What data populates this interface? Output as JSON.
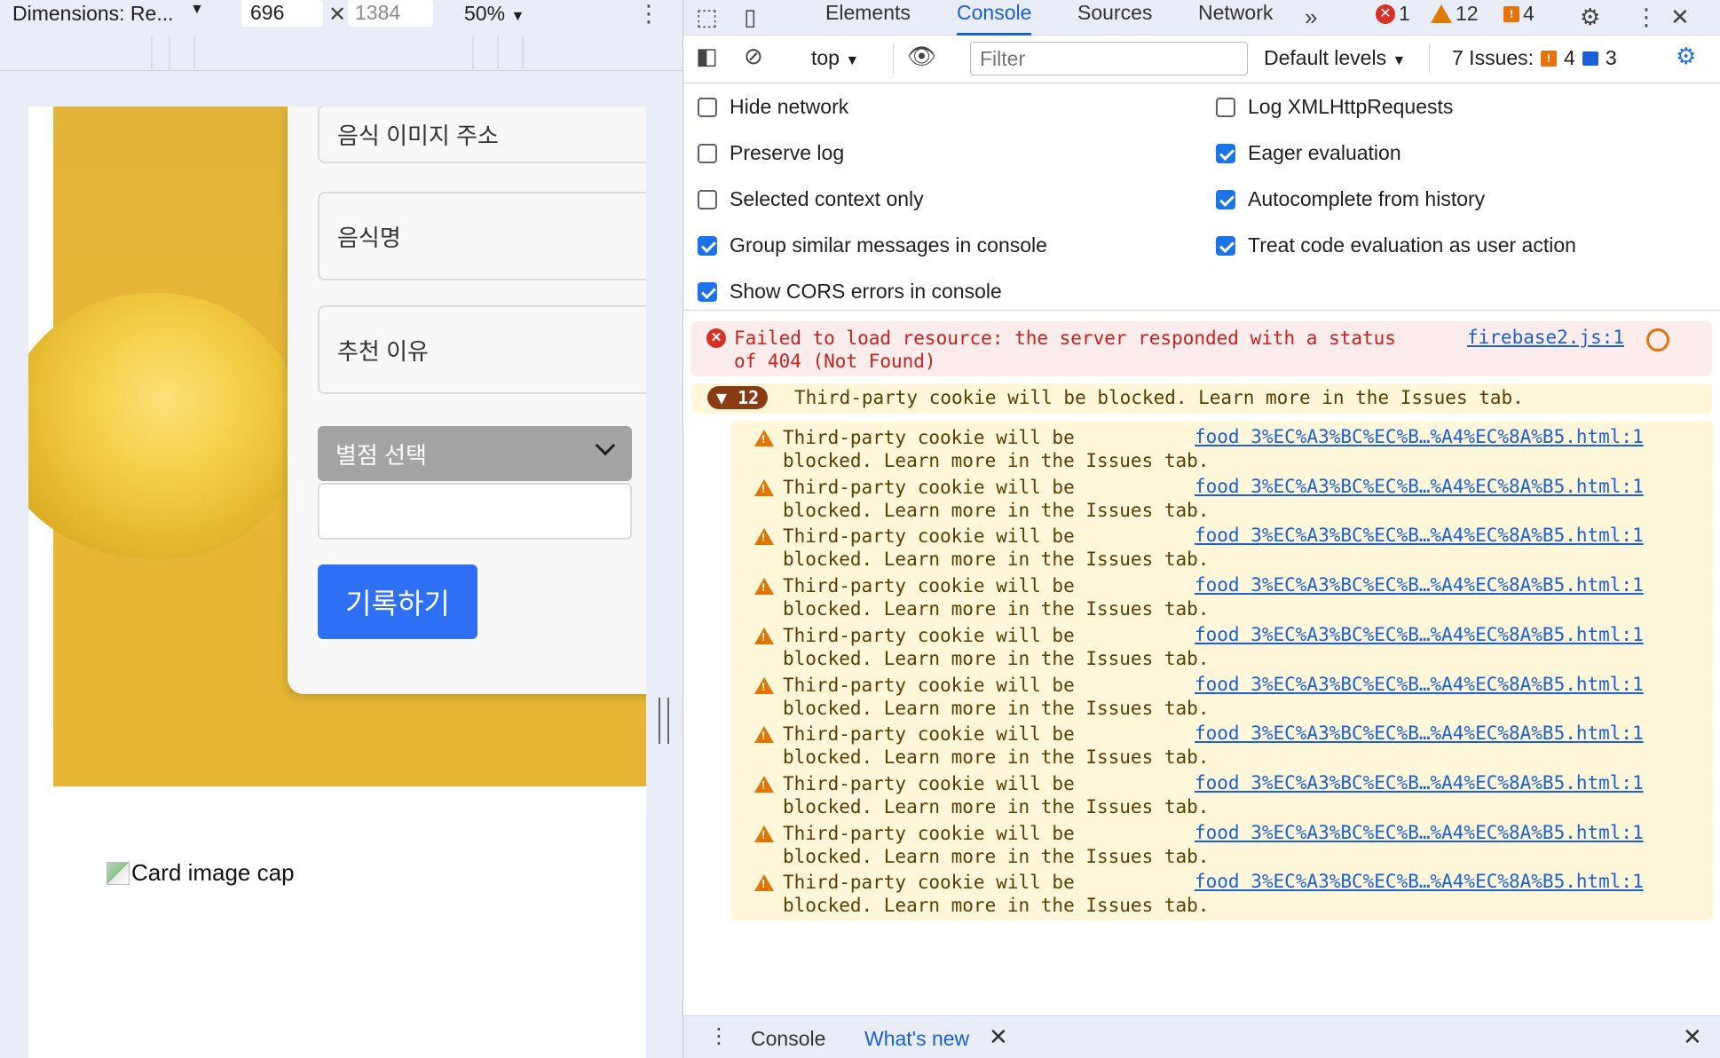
{
  "device_toolbar": {
    "dimensions_label": "Dimensions: Re...",
    "width_value": "696",
    "height_value": "1384",
    "zoom_label": "50%"
  },
  "page": {
    "fields": [
      "음식 이미지 주소",
      "음식명",
      "추천 이유"
    ],
    "rating_select_label": "별점 선택",
    "submit_label": "기록하기",
    "card_image_alt": "Card image cap"
  },
  "devtools": {
    "tabs": [
      "Elements",
      "Console",
      "Sources",
      "Network"
    ],
    "counts": {
      "errors": "1",
      "warnings": "12",
      "issues": "4"
    },
    "toolbar": {
      "context": "top",
      "filter_placeholder": "Filter",
      "levels": "Default levels",
      "issues_label": "7 Issues:",
      "issues_warn": "4",
      "issues_info": "3"
    },
    "settings": {
      "left": [
        {
          "label": "Hide network",
          "checked": false
        },
        {
          "label": "Preserve log",
          "checked": false
        },
        {
          "label": "Selected context only",
          "checked": false
        },
        {
          "label": "Group similar messages in console",
          "checked": true
        },
        {
          "label": "Show CORS errors in console",
          "checked": true
        }
      ],
      "right": [
        {
          "label": "Log XMLHttpRequests",
          "checked": false
        },
        {
          "label": "Eager evaluation",
          "checked": true
        },
        {
          "label": "Autocomplete from history",
          "checked": true
        },
        {
          "label": "Treat code evaluation as user action",
          "checked": true
        }
      ]
    },
    "console": {
      "error_text": "Failed to load resource: the server responded with a status\nof 404 (Not Found)",
      "error_link": "firebase2.js:1",
      "group_count": "12",
      "group_text": "Third-party cookie will be blocked. Learn more in the Issues tab.",
      "warning_text": "Third-party cookie will be\nblocked. Learn more in the Issues tab.",
      "warning_link": "food 3%EC%A3%BC%EC%B…%A4%EC%8A%B5.html:1",
      "warning_rows": 10
    },
    "drawer": {
      "tab_console": "Console",
      "tab_whats_new": "What's new"
    }
  }
}
